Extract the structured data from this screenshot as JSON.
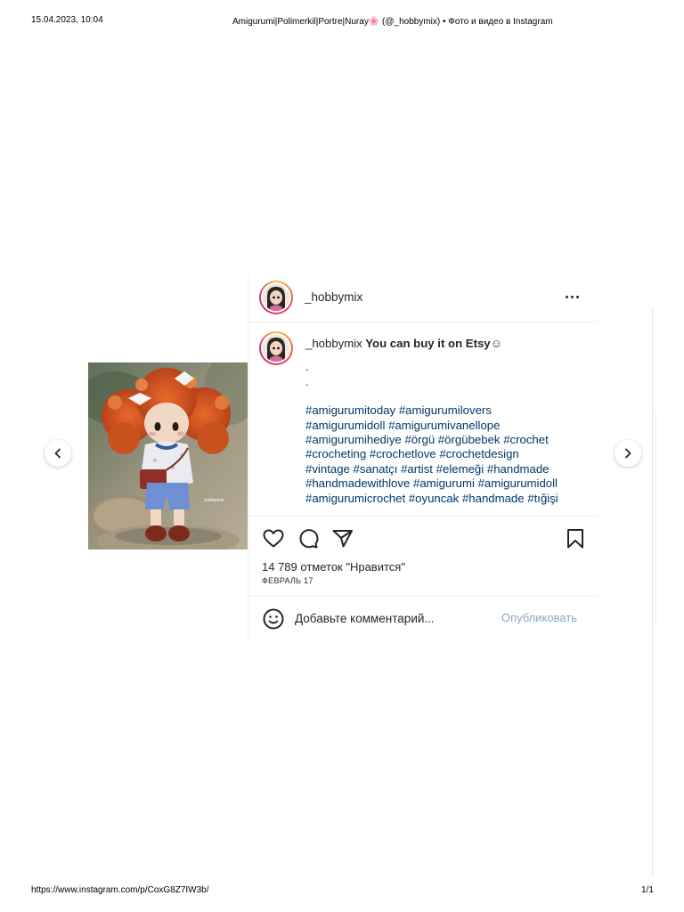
{
  "print": {
    "datetime": "15.04.2023, 10:04",
    "title": "Amigurumi|Polimerkil|Portre|Nuray🌸 (@_hobbymix) • Фото и видео в Instagram",
    "url": "https://www.instagram.com/p/CoxG8Z7IW3b/",
    "page": "1/1"
  },
  "post": {
    "username": "_hobbymix",
    "photo_watermark": "_hobbymix",
    "caption": {
      "username": "_hobbymix",
      "text": " You can buy it on Etsy☺",
      "dots": [
        ".",
        "."
      ],
      "hashtags": [
        "#amigurumitoday",
        "#amigurumilovers",
        "#amigurumidoll",
        "#amigurumivanellope",
        "#amigurumihediye",
        "#örgü",
        "#örgübebek",
        "#crochet",
        "#crocheting",
        "#crochetlove",
        "#crochetdesign",
        "#vintage",
        "#sanatçı",
        "#artist",
        "#elemeği",
        "#handmade",
        "#handmadewithlove",
        "#amigurumi",
        "#amigurumidoll",
        "#amigurumicrochet",
        "#oyuncak",
        "#handmade",
        "#tığişi"
      ]
    },
    "likes": "14 789 отметок \"Нравится\"",
    "date": "ФЕВРАЛЬ 17",
    "comment_placeholder": "Добавьте комментарий...",
    "publish_label": "Опубликовать"
  },
  "icons": {
    "heart": "heart-icon",
    "comment": "comment-icon",
    "share": "share-icon",
    "bookmark": "bookmark-icon",
    "emoji": "emoji-icon",
    "more": "more-options-icon",
    "prev": "chevron-left-icon",
    "next": "chevron-right-icon"
  },
  "colors": {
    "hashtag": "#00376b",
    "publish": "#8aa6c4",
    "text": "#262626",
    "divider": "#efefef"
  }
}
